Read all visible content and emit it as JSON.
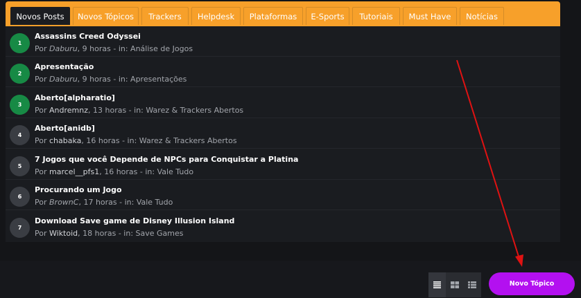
{
  "tabs": [
    {
      "label": "Novos Posts"
    },
    {
      "label": "Novos Tópicos"
    },
    {
      "label": "Trackers"
    },
    {
      "label": "Helpdesk"
    },
    {
      "label": "Plataformas"
    },
    {
      "label": "E-Sports"
    },
    {
      "label": "Tutoriais"
    },
    {
      "label": "Must Have"
    },
    {
      "label": "Notícias"
    }
  ],
  "posts": [
    {
      "number": "1",
      "title": "Assassins Creed Odyssei",
      "by": "Por",
      "author": "Daburu",
      "time": ", 9 horas - in: Análise de Jogos"
    },
    {
      "number": "2",
      "title": "Apresentação",
      "by": "Por",
      "author": "Daburu",
      "time": ", 9 horas - in: Apresentações"
    },
    {
      "number": "3",
      "title": "Aberto[alpharatio]",
      "by": "Por",
      "author": "Andremnz",
      "time": ", 13 horas - in: Warez & Trackers Abertos"
    },
    {
      "number": "4",
      "title": "Aberto[anidb]",
      "by": "Por",
      "author": "chabaka",
      "time": ", 16 horas - in: Warez & Trackers Abertos"
    },
    {
      "number": "5",
      "title": "7 Jogos que você Depende de NPCs para Conquistar a Platina",
      "by": "Por",
      "author": "marcel__pfs1",
      "time": ", 16 horas - in: Vale Tudo"
    },
    {
      "number": "6",
      "title": "Procurando um Jogo",
      "by": "Por",
      "author": "BrownC",
      "time": ", 17 horas - in: Vale Tudo"
    },
    {
      "number": "7",
      "title": "Download Save game de Disney Illusion Island",
      "by": "Por",
      "author": "Wiktoid",
      "time": ", 18 horas - in: Save Games"
    }
  ],
  "new_topic": {
    "label": "Novo Tópico"
  },
  "icons": {
    "list": "list-view-icon",
    "grid": "grid-view-icon",
    "detail": "detail-list-icon"
  },
  "colors": {
    "tabbar": "#f7a02a",
    "button": "#b310f0",
    "green_badge": "#178a45",
    "arrow": "#e01212"
  }
}
